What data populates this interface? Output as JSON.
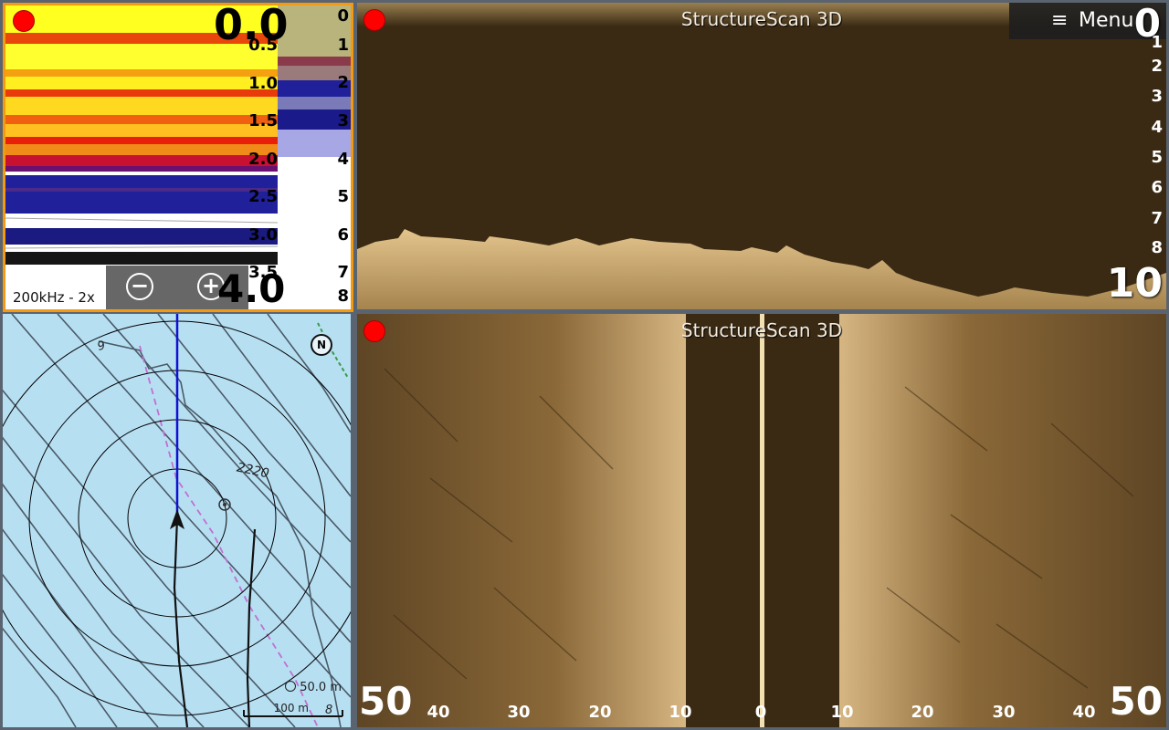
{
  "sonar": {
    "depth_top": "0.0",
    "depth_bottom": "4.0",
    "scale": [
      "0.5",
      "1.0",
      "1.5",
      "2.0",
      "2.5",
      "3.0",
      "3.5"
    ],
    "strip_scale": [
      "0",
      "1",
      "2",
      "3",
      "4",
      "5",
      "6",
      "7",
      "8"
    ],
    "frequency": "200kHz - 2x",
    "zoom_out_label": "−",
    "zoom_in_label": "+"
  },
  "structurescan_down": {
    "title": "StructureScan 3D",
    "menu_label": "Menu",
    "menu_icon": "hamburger-icon",
    "depth_top": "0",
    "depth_bottom": "10",
    "scale": [
      "1",
      "2",
      "3",
      "4",
      "5",
      "6",
      "7",
      "8"
    ]
  },
  "chart": {
    "contour_9": "9",
    "contour_2220": "2220",
    "scale_range": "50.0 m",
    "scale_bar": "100 m",
    "contour_8": "8",
    "north_label": "N"
  },
  "structurescan_side": {
    "title": "StructureScan 3D",
    "range_left": "50",
    "range_right": "50",
    "range_ticks": [
      "40",
      "30",
      "20",
      "10",
      "0",
      "10",
      "20",
      "30",
      "40"
    ]
  },
  "colors": {
    "accent": "#f49a10",
    "record": "#ff0000",
    "sonar_bg": "#3a2a14",
    "chart_water": "#b7dff2"
  }
}
